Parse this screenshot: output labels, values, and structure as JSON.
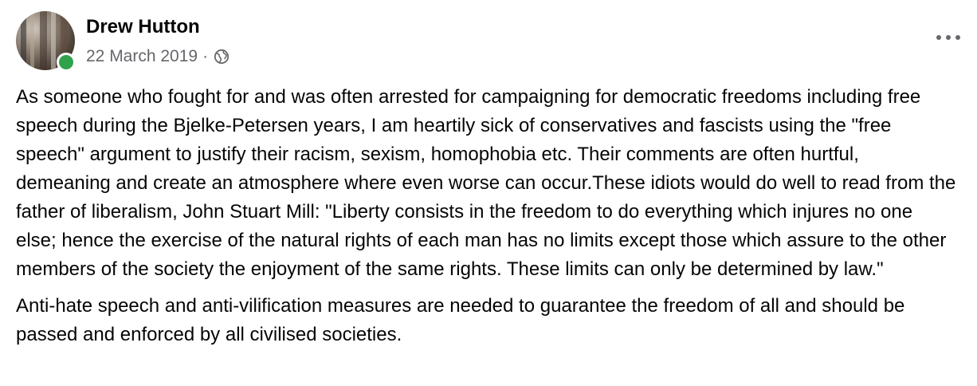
{
  "post": {
    "author": {
      "name": "Drew Hutton",
      "avatar_icon": "profile-photo",
      "online": true,
      "online_color": "#31a24c"
    },
    "meta": {
      "date": "22 March 2019",
      "separator": "·",
      "audience_icon": "globe-icon"
    },
    "more_icon": "more-horizontal-icon",
    "paragraphs": [
      "As someone who fought for and was often arrested for campaigning for democratic freedoms including free speech during the Bjelke-Petersen years, I am heartily sick of conservatives and fascists using the \"free speech\" argument to justify their racism, sexism, homophobia etc. Their comments are often hurtful, demeaning and create an atmosphere where even worse can occur.These idiots would do well to read from the father of liberalism, John Stuart Mill: \"Liberty consists in the freedom to do everything which injures no one else; hence the exercise of the natural rights of each man has no limits except those which assure to the other members of the society the enjoyment of the same rights. These limits can only be determined by law.\"",
      "Anti-hate speech and anti-vilification measures are needed to guarantee the freedom of all and should be passed and enforced by all civilised societies."
    ]
  }
}
